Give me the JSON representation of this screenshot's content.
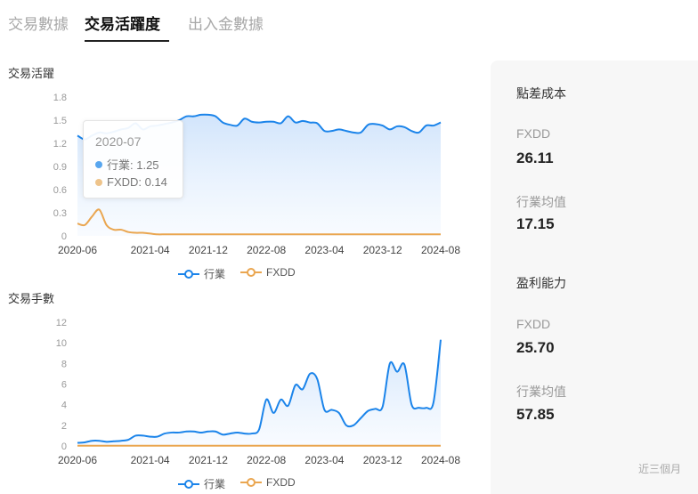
{
  "tabs": [
    {
      "label": "交易數據",
      "active": false
    },
    {
      "label": "交易活躍度",
      "active": true
    },
    {
      "label": "出入金數據",
      "active": false
    }
  ],
  "colors": {
    "industry": "#1b84ea",
    "fxdd": "#eaa650",
    "industry_fill": "#e1eefc"
  },
  "chart_data": [
    {
      "type": "line",
      "title": "交易活躍",
      "x_ticks": [
        "2020-06",
        "2021-04",
        "2021-12",
        "2022-08",
        "2023-04",
        "2023-12",
        "2024-08"
      ],
      "y_ticks": [
        "0",
        "0.3",
        "0.6",
        "0.9",
        "1.2",
        "1.5",
        "1.8"
      ],
      "ylim": [
        0,
        1.8
      ],
      "x": [
        "2020-06",
        "2020-07",
        "2020-08",
        "2020-09",
        "2020-10",
        "2020-11",
        "2020-12",
        "2021-01",
        "2021-02",
        "2021-03",
        "2021-04",
        "2021-05",
        "2021-06",
        "2021-07",
        "2021-08",
        "2021-09",
        "2021-10",
        "2021-11",
        "2021-12",
        "2022-01",
        "2022-02",
        "2022-03",
        "2022-04",
        "2022-05",
        "2022-06",
        "2022-07",
        "2022-08",
        "2022-09",
        "2022-10",
        "2022-11",
        "2022-12",
        "2023-01",
        "2023-02",
        "2023-03",
        "2023-04",
        "2023-05",
        "2023-06",
        "2023-07",
        "2023-08",
        "2023-09",
        "2023-10",
        "2023-11",
        "2023-12",
        "2024-01",
        "2024-02",
        "2024-03",
        "2024-04",
        "2024-05",
        "2024-06",
        "2024-07",
        "2024-08"
      ],
      "series": [
        {
          "name": "行業",
          "values": [
            1.3,
            1.25,
            1.3,
            1.34,
            1.33,
            1.35,
            1.38,
            1.4,
            1.46,
            1.38,
            1.42,
            1.43,
            1.45,
            1.47,
            1.5,
            1.55,
            1.55,
            1.57,
            1.57,
            1.55,
            1.47,
            1.44,
            1.43,
            1.52,
            1.48,
            1.47,
            1.48,
            1.48,
            1.46,
            1.55,
            1.47,
            1.49,
            1.47,
            1.46,
            1.36,
            1.36,
            1.38,
            1.36,
            1.34,
            1.34,
            1.44,
            1.45,
            1.43,
            1.38,
            1.42,
            1.41,
            1.36,
            1.34,
            1.43,
            1.43,
            1.47
          ]
        },
        {
          "name": "FXDD",
          "values": [
            0.16,
            0.14,
            0.25,
            0.34,
            0.14,
            0.08,
            0.08,
            0.05,
            0.04,
            0.04,
            0.03,
            0.02,
            0.02,
            0.02,
            0.02,
            0.02,
            0.02,
            0.02,
            0.02,
            0.02,
            0.02,
            0.02,
            0.02,
            0.02,
            0.02,
            0.02,
            0.02,
            0.02,
            0.02,
            0.02,
            0.02,
            0.02,
            0.02,
            0.02,
            0.02,
            0.02,
            0.02,
            0.02,
            0.02,
            0.02,
            0.02,
            0.02,
            0.02,
            0.02,
            0.02,
            0.02,
            0.02,
            0.02,
            0.02,
            0.02,
            0.02
          ]
        }
      ],
      "tooltip": {
        "title": "2020-07",
        "rows": [
          {
            "label": "行業: 1.25"
          },
          {
            "label": "FXDD: 0.14"
          }
        ]
      },
      "legend": "bottom-center"
    },
    {
      "type": "line",
      "title": "交易手數",
      "x_ticks": [
        "2020-06",
        "2021-04",
        "2021-12",
        "2022-08",
        "2023-04",
        "2023-12",
        "2024-08"
      ],
      "y_ticks": [
        "0",
        "2",
        "4",
        "6",
        "8",
        "10",
        "12"
      ],
      "ylim": [
        0,
        12
      ],
      "x": [
        "2020-06",
        "2020-07",
        "2020-08",
        "2020-09",
        "2020-10",
        "2020-11",
        "2020-12",
        "2021-01",
        "2021-02",
        "2021-03",
        "2021-04",
        "2021-05",
        "2021-06",
        "2021-07",
        "2021-08",
        "2021-09",
        "2021-10",
        "2021-11",
        "2021-12",
        "2022-01",
        "2022-02",
        "2022-03",
        "2022-04",
        "2022-05",
        "2022-06",
        "2022-07",
        "2022-08",
        "2022-09",
        "2022-10",
        "2022-11",
        "2022-12",
        "2023-01",
        "2023-02",
        "2023-03",
        "2023-04",
        "2023-05",
        "2023-06",
        "2023-07",
        "2023-08",
        "2023-09",
        "2023-10",
        "2023-11",
        "2023-12",
        "2024-01",
        "2024-02",
        "2024-03",
        "2024-04",
        "2024-05",
        "2024-06",
        "2024-07",
        "2024-08"
      ],
      "series": [
        {
          "name": "行業",
          "values": [
            0.3,
            0.35,
            0.5,
            0.5,
            0.4,
            0.45,
            0.5,
            0.6,
            1.0,
            1.0,
            0.9,
            0.9,
            1.2,
            1.3,
            1.3,
            1.4,
            1.4,
            1.3,
            1.4,
            1.4,
            1.1,
            1.2,
            1.3,
            1.2,
            1.2,
            1.6,
            4.5,
            3.2,
            4.5,
            3.9,
            5.9,
            5.5,
            7.0,
            6.5,
            3.5,
            3.5,
            3.2,
            2.0,
            2.0,
            2.7,
            3.4,
            3.6,
            3.8,
            8.0,
            7.2,
            7.9,
            4.0,
            3.7,
            3.7,
            4.2,
            10.3
          ]
        },
        {
          "name": "FXDD",
          "values": [
            0.02,
            0.02,
            0.02,
            0.02,
            0.02,
            0.02,
            0.02,
            0.02,
            0.02,
            0.02,
            0.02,
            0.02,
            0.02,
            0.02,
            0.02,
            0.02,
            0.02,
            0.02,
            0.02,
            0.02,
            0.02,
            0.02,
            0.02,
            0.02,
            0.02,
            0.02,
            0.02,
            0.02,
            0.02,
            0.02,
            0.02,
            0.02,
            0.02,
            0.02,
            0.02,
            0.02,
            0.02,
            0.02,
            0.02,
            0.02,
            0.02,
            0.02,
            0.02,
            0.02,
            0.02,
            0.02,
            0.02,
            0.02,
            0.02,
            0.02,
            0.02
          ]
        }
      ],
      "legend": "bottom-center"
    }
  ],
  "legend_labels": {
    "industry": "行業",
    "fxdd": "FXDD"
  },
  "side_panel": {
    "spread": {
      "title": "點差成本",
      "fxdd_label": "FXDD",
      "fxdd_value": "26.11",
      "industry_label": "行業均值",
      "industry_value": "17.15"
    },
    "profit": {
      "title": "盈利能力",
      "fxdd_label": "FXDD",
      "fxdd_value": "25.70",
      "industry_label": "行業均值",
      "industry_value": "57.85"
    },
    "footnote": "近三個月"
  }
}
